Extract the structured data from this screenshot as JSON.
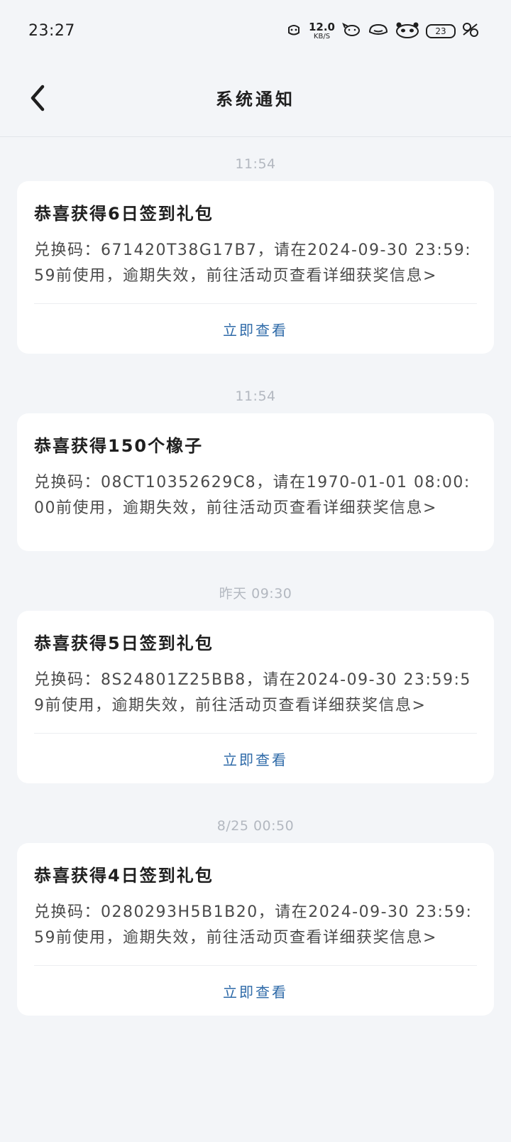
{
  "status_bar": {
    "time": "23:27",
    "net_speed_value": "12.0",
    "net_speed_unit": "KB/S",
    "battery_level": "23",
    "icons": [
      "face-icon",
      "dog-icon",
      "frog-icon",
      "panda-icon",
      "battery-icon",
      "bug-icon"
    ]
  },
  "header": {
    "title": "系统通知",
    "back_icon": "chevron-left-icon"
  },
  "messages": [
    {
      "time": "11:54",
      "title": "恭喜获得6日签到礼包",
      "body": "兑换码：671420T38G17B7，请在2024-09-30 23:59:59前使用，逾期失效，前往活动页查看详细获奖信息>",
      "action": "立即查看"
    },
    {
      "time": "11:54",
      "title": "恭喜获得150个橡子",
      "body": "兑换码：08CT10352629C8，请在1970-01-01 08:00:00前使用，逾期失效，前往活动页查看详细获奖信息>",
      "action": ""
    },
    {
      "time": "昨天   09:30",
      "title": "恭喜获得5日签到礼包",
      "body": "兑换码：8S24801Z25BB8，请在2024-09-30 23:59:59前使用，逾期失效，前往活动页查看详细获奖信息>",
      "action": "立即查看"
    },
    {
      "time": "8/25   00:50",
      "title": "恭喜获得4日签到礼包",
      "body": "兑换码：0280293H5B1B20，请在2024-09-30 23:59:59前使用，逾期失效，前往活动页查看详细获奖信息>",
      "action": "立即查看"
    }
  ],
  "colors": {
    "background": "#f3f5f8",
    "card": "#ffffff",
    "link": "#2e6aa8",
    "time_text": "#b3b8c0"
  }
}
